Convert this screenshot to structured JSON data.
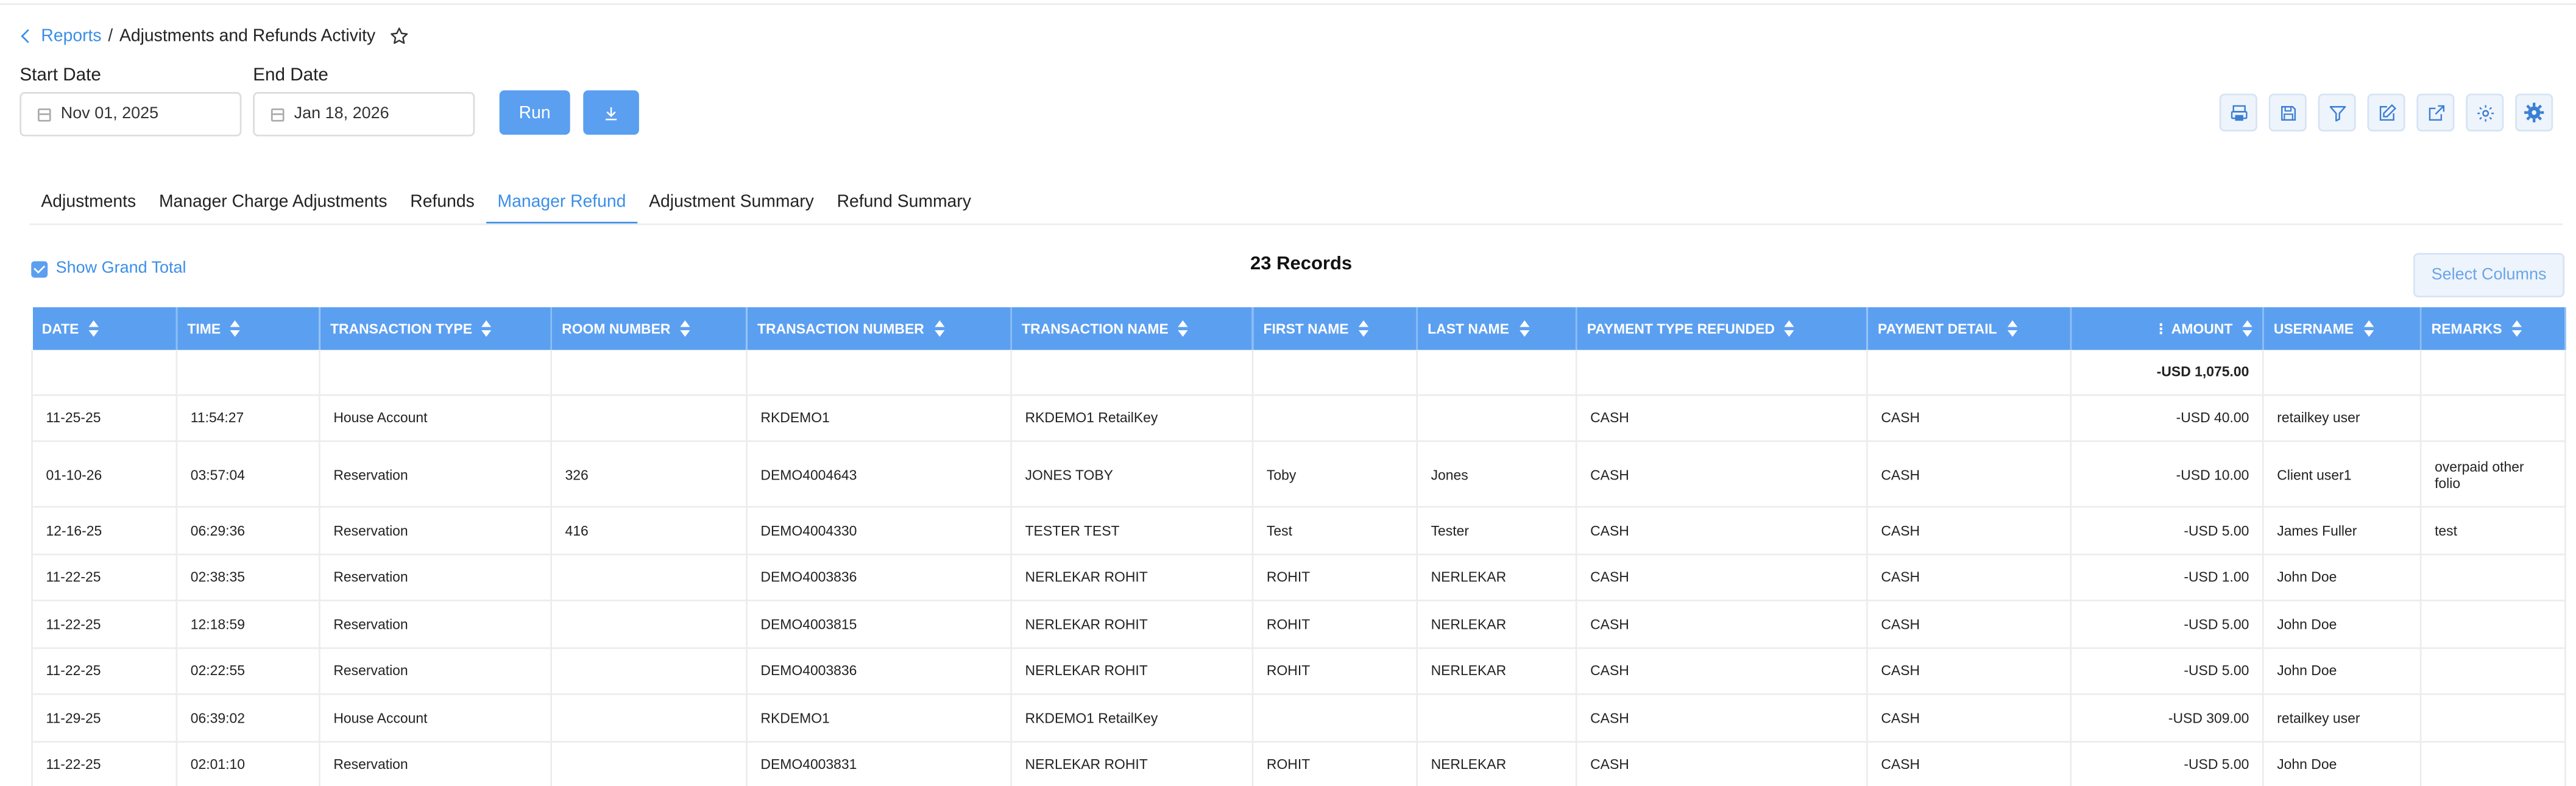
{
  "breadcrumb": {
    "parent": "Reports",
    "separator": "/",
    "current": "Adjustments and Refunds Activity"
  },
  "filters": {
    "start_label": "Start Date",
    "start_value": "Nov 01, 2025",
    "end_label": "End Date",
    "end_value": "Jan 18, 2026"
  },
  "buttons": {
    "run": "Run",
    "select_columns": "Select Columns"
  },
  "toolbar_icons": [
    "print-icon",
    "save-icon",
    "filter-icon",
    "edit-icon",
    "export-icon",
    "settings-icon",
    "gear-settings-icon"
  ],
  "tabs": [
    {
      "label": "Adjustments"
    },
    {
      "label": "Manager Charge Adjustments"
    },
    {
      "label": "Refunds"
    },
    {
      "label": "Manager Refund",
      "active": true
    },
    {
      "label": "Adjustment Summary"
    },
    {
      "label": "Refund Summary"
    }
  ],
  "grand_total_label": "Show Grand Total",
  "records_label": "23 Records",
  "table": {
    "headers": [
      "DATE",
      "TIME",
      "TRANSACTION TYPE",
      "ROOM NUMBER",
      "TRANSACTION NUMBER",
      "TRANSACTION NAME",
      "FIRST NAME",
      "LAST NAME",
      "PAYMENT TYPE REFUNDED",
      "PAYMENT DETAIL",
      "AMOUNT",
      "USERNAME",
      "REMARKS"
    ],
    "total_amount": "-USD 1,075.00",
    "rows": [
      [
        "11-25-25",
        "11:54:27",
        "House Account",
        "",
        "RKDEMO1",
        "RKDEMO1 RetailKey",
        "",
        "",
        "CASH",
        "CASH",
        "-USD 40.00",
        "retailkey user",
        ""
      ],
      [
        "01-10-26",
        "03:57:04",
        "Reservation",
        "326",
        "DEMO4004643",
        "JONES TOBY",
        "Toby",
        "Jones",
        "CASH",
        "CASH",
        "-USD 10.00",
        "Client user1",
        "overpaid other folio"
      ],
      [
        "12-16-25",
        "06:29:36",
        "Reservation",
        "416",
        "DEMO4004330",
        "TESTER TEST",
        "Test",
        "Tester",
        "CASH",
        "CASH",
        "-USD 5.00",
        "James Fuller",
        "test"
      ],
      [
        "11-22-25",
        "02:38:35",
        "Reservation",
        "",
        "DEMO4003836",
        "NERLEKAR ROHIT",
        "ROHIT",
        "NERLEKAR",
        "CASH",
        "CASH",
        "-USD 1.00",
        "John Doe",
        ""
      ],
      [
        "11-22-25",
        "12:18:59",
        "Reservation",
        "",
        "DEMO4003815",
        "NERLEKAR ROHIT",
        "ROHIT",
        "NERLEKAR",
        "CASH",
        "CASH",
        "-USD 5.00",
        "John Doe",
        ""
      ],
      [
        "11-22-25",
        "02:22:55",
        "Reservation",
        "",
        "DEMO4003836",
        "NERLEKAR ROHIT",
        "ROHIT",
        "NERLEKAR",
        "CASH",
        "CASH",
        "-USD 5.00",
        "John Doe",
        ""
      ],
      [
        "11-29-25",
        "06:39:02",
        "House Account",
        "",
        "RKDEMO1",
        "RKDEMO1 RetailKey",
        "",
        "",
        "CASH",
        "CASH",
        "-USD 309.00",
        "retailkey user",
        ""
      ],
      [
        "11-22-25",
        "02:01:10",
        "Reservation",
        "",
        "DEMO4003831",
        "NERLEKAR ROHIT",
        "ROHIT",
        "NERLEKAR",
        "CASH",
        "CASH",
        "-USD 5.00",
        "John Doe",
        ""
      ]
    ]
  }
}
